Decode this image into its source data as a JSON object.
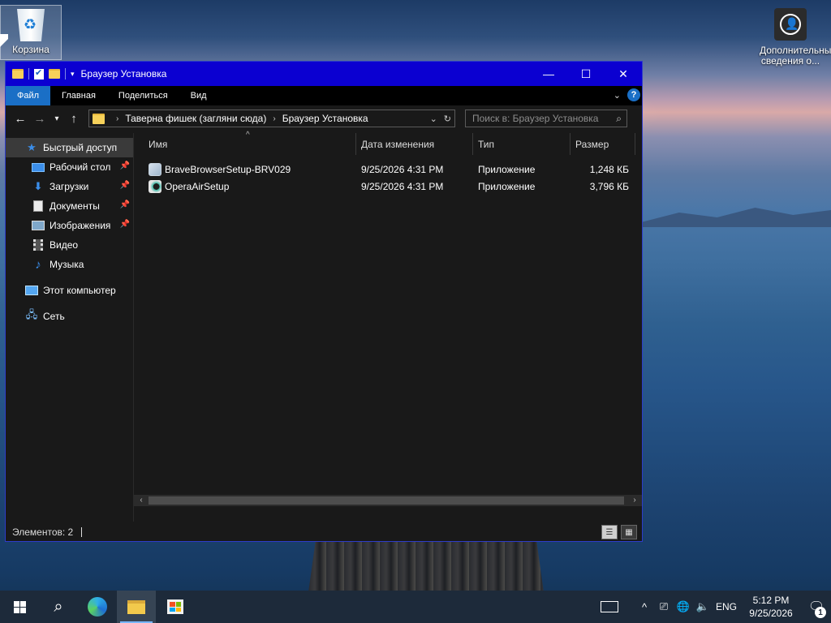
{
  "desktop": {
    "recycle_bin_label": "Корзина",
    "more_info_label": "Дополнительные сведения о..."
  },
  "window": {
    "title": "Браузер Установка",
    "controls": {
      "minimize": "—",
      "maximize": "☐",
      "close": "✕"
    }
  },
  "ribbon": {
    "tabs": [
      "Файл",
      "Главная",
      "Поделиться",
      "Вид"
    ],
    "active_tab": "Файл",
    "help": "?"
  },
  "address": {
    "crumbs": [
      "Таверна фишек (загляни сюда)",
      "Браузер Установка"
    ]
  },
  "search": {
    "placeholder": "Поиск в: Браузер Установка"
  },
  "nav_pane": {
    "quick_access": "Быстрый доступ",
    "items": [
      {
        "label": "Рабочий стол",
        "icon": "desktop-icon",
        "pinned": true
      },
      {
        "label": "Загрузки",
        "icon": "downloads-icon",
        "pinned": true
      },
      {
        "label": "Документы",
        "icon": "documents-icon",
        "pinned": true
      },
      {
        "label": "Изображения",
        "icon": "pictures-icon",
        "pinned": true
      },
      {
        "label": "Видео",
        "icon": "video-icon",
        "pinned": false
      },
      {
        "label": "Музыка",
        "icon": "music-icon",
        "pinned": false
      }
    ],
    "this_pc": "Этот компьютер",
    "network": "Сеть"
  },
  "columns": {
    "name": "Имя",
    "date": "Дата изменения",
    "type": "Тип",
    "size": "Размер"
  },
  "files": [
    {
      "name": "BraveBrowserSetup-BRV029",
      "date": "9/25/2026 4:31 PM",
      "type": "Приложение",
      "size": "1,248 КБ",
      "icon": "brave-installer-icon"
    },
    {
      "name": "OperaAirSetup",
      "date": "9/25/2026 4:31 PM",
      "type": "Приложение",
      "size": "3,796 КБ",
      "icon": "opera-installer-icon"
    }
  ],
  "status": {
    "items_count": "Элементов: 2"
  },
  "taskbar": {
    "lang": "ENG",
    "time": "5:12 PM",
    "date": "9/25/2026",
    "notifications": "1"
  },
  "colors": {
    "titlebar": "#0b00d1",
    "accent": "#1a6fc6",
    "window_bg": "#191919",
    "taskbar": "#1d2a3a"
  }
}
